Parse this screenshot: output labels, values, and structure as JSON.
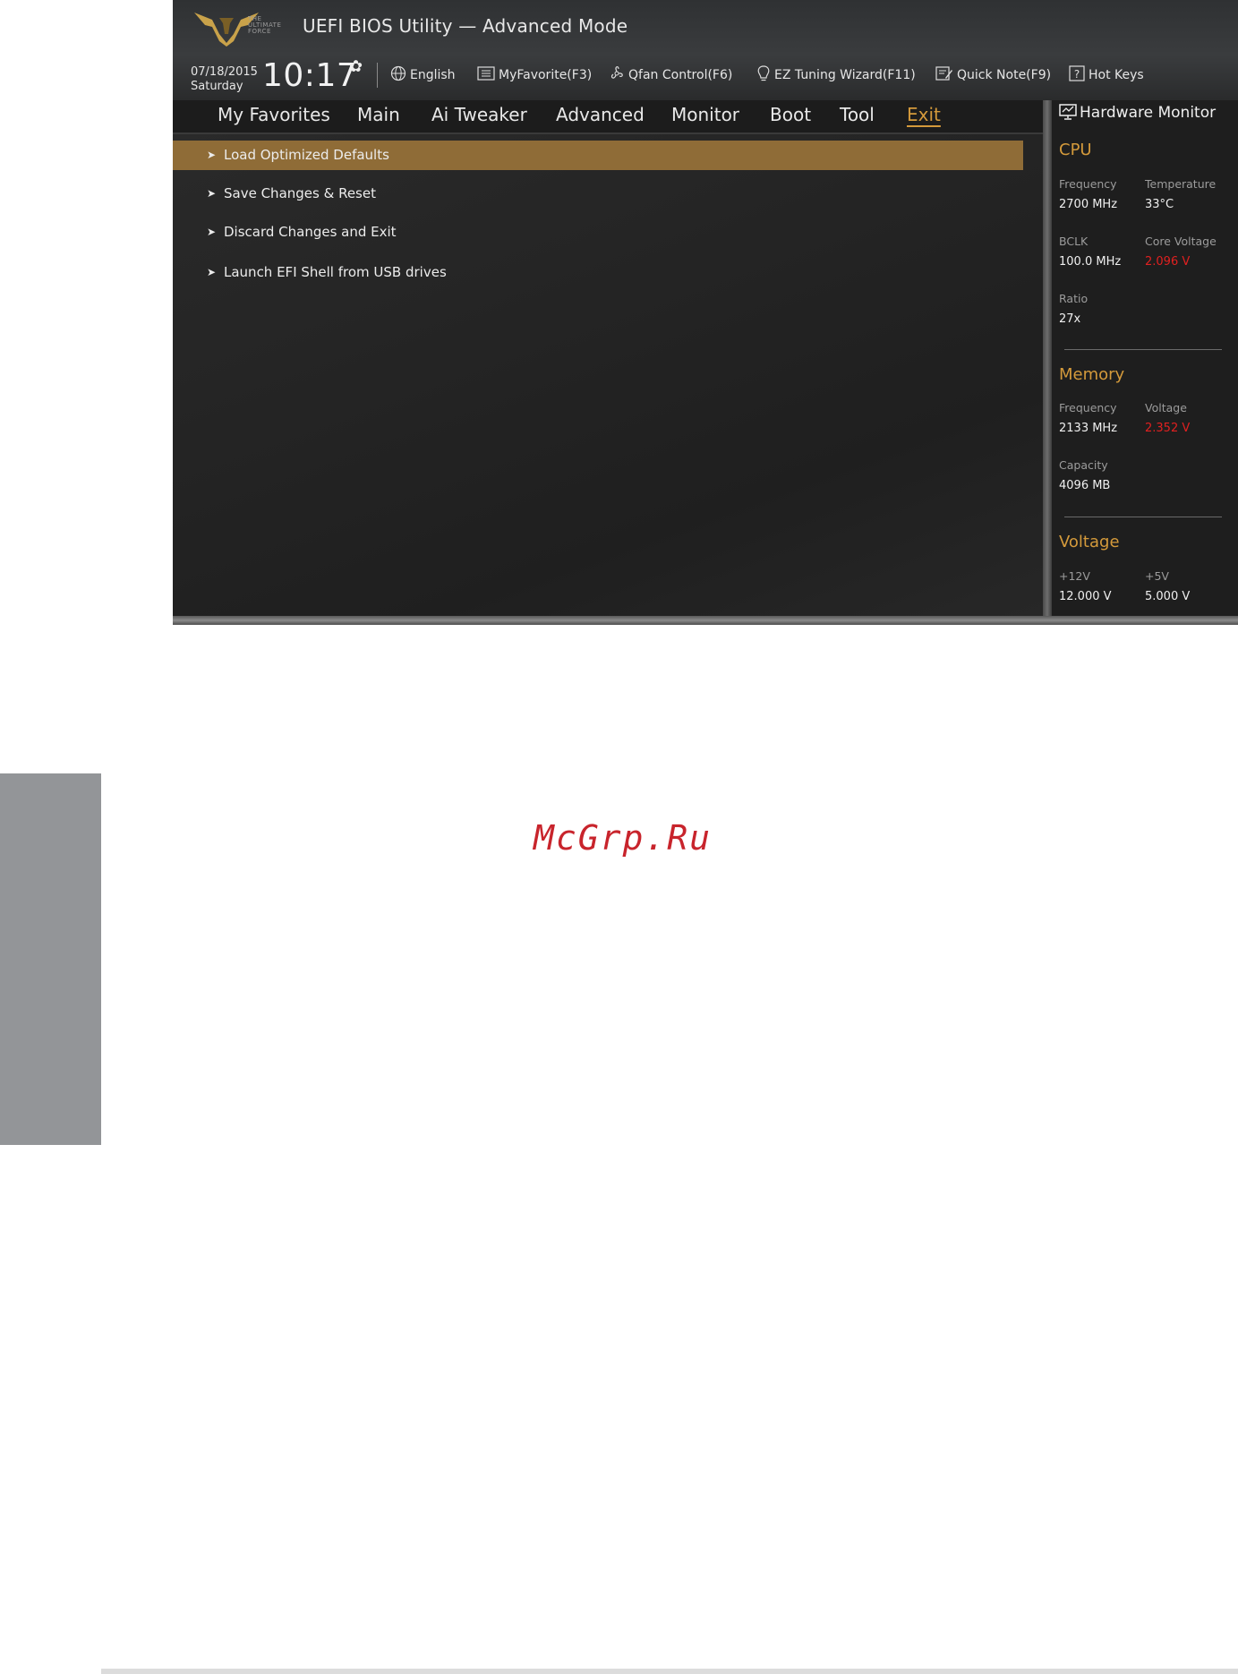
{
  "header": {
    "logo_text": [
      "THE",
      "ULTIMATE",
      "FORCE"
    ],
    "title": "UEFI BIOS Utility — Advanced Mode",
    "date": "07/18/2015",
    "day": "Saturday",
    "time": "10:17",
    "tools": [
      {
        "label": "English",
        "icon": "globe-icon"
      },
      {
        "label": "MyFavorite(F3)",
        "icon": "favorite-list-icon"
      },
      {
        "label": "Qfan Control(F6)",
        "icon": "fan-icon"
      },
      {
        "label": "EZ Tuning Wizard(F11)",
        "icon": "lightbulb-icon"
      },
      {
        "label": "Quick Note(F9)",
        "icon": "note-icon"
      },
      {
        "label": "Hot Keys",
        "icon": "question-icon"
      }
    ]
  },
  "tabs": [
    {
      "label": "My Favorites"
    },
    {
      "label": "Main"
    },
    {
      "label": "Ai Tweaker"
    },
    {
      "label": "Advanced"
    },
    {
      "label": "Monitor"
    },
    {
      "label": "Boot"
    },
    {
      "label": "Tool"
    },
    {
      "label": "Exit",
      "active": true
    }
  ],
  "menu": [
    {
      "label": "Load Optimized Defaults",
      "selected": true
    },
    {
      "label": "Save Changes & Reset"
    },
    {
      "label": "Discard Changes and Exit"
    },
    {
      "label": "Launch EFI Shell from USB drives"
    }
  ],
  "hardware_monitor": {
    "title": "Hardware Monitor",
    "cpu": {
      "heading": "CPU",
      "frequency_label": "Frequency",
      "frequency": "2700 MHz",
      "temperature_label": "Temperature",
      "temperature": "33°C",
      "bclk_label": "BCLK",
      "bclk": "100.0 MHz",
      "core_voltage_label": "Core Voltage",
      "core_voltage": "2.096 V",
      "ratio_label": "Ratio",
      "ratio": "27x"
    },
    "memory": {
      "heading": "Memory",
      "frequency_label": "Frequency",
      "frequency": "2133 MHz",
      "voltage_label": "Voltage",
      "voltage": "2.352 V",
      "capacity_label": "Capacity",
      "capacity": "4096 MB"
    },
    "voltage": {
      "heading": "Voltage",
      "v12_label": "+12V",
      "v12": "12.000 V",
      "v5_label": "+5V",
      "v5": "5.000 V"
    }
  },
  "watermark": "McGrp.Ru",
  "colors": {
    "accent": "#d49a3b",
    "selected_row": "#8f6c37",
    "warning": "#e02020",
    "side_tab": "#939598"
  }
}
